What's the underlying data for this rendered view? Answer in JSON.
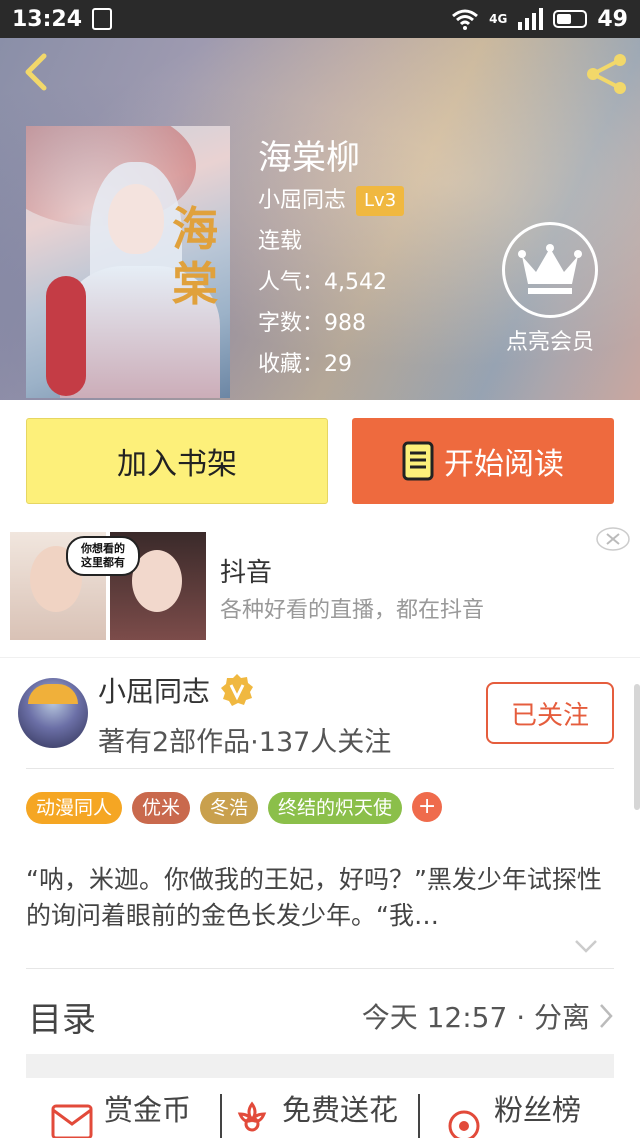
{
  "status_bar": {
    "time": "13:24",
    "network": "4G",
    "battery": "49"
  },
  "book": {
    "title": "海棠柳",
    "cover_text": "海棠",
    "author": "小屈同志",
    "author_level": "Lv3",
    "status": "连载",
    "popularity_label": "人气：",
    "popularity": "4,542",
    "words_label": "字数：",
    "words": "988",
    "favorites_label": "收藏：",
    "favorites": "29"
  },
  "vip": {
    "label": "点亮会员"
  },
  "actions": {
    "add_shelf": "加入书架",
    "start_read": "开始阅读"
  },
  "ad": {
    "bubble_text": "你想看的这里都有",
    "title": "抖音",
    "desc": "各种好看的直播，都在抖音"
  },
  "author_card": {
    "name": "小屈同志",
    "stats": "著有2部作品·137人关注",
    "follow_label": "已关注"
  },
  "tags": [
    {
      "label": "动漫同人",
      "color": "#f5a623"
    },
    {
      "label": "优米",
      "color": "#c9694d"
    },
    {
      "label": "冬浩",
      "color": "#c9a04d"
    },
    {
      "label": "终结的炽天使",
      "color": "#8bbf4a"
    }
  ],
  "tag_add": "+",
  "synopsis": "“呐，米迦。你做我的王妃，好吗？”黑发少年试探性的询问着眼前的金色长发少年。“我…",
  "toc": {
    "label": "目录",
    "latest": "今天 12:57 · 分离"
  },
  "bottom_bar": {
    "reward": "赏金币",
    "flower": "免费送花",
    "fans": "粉丝榜"
  },
  "colors": {
    "accent_orange": "#ee6a3e",
    "shelf_yellow": "#fdf07a",
    "level_badge": "#f0b840"
  }
}
